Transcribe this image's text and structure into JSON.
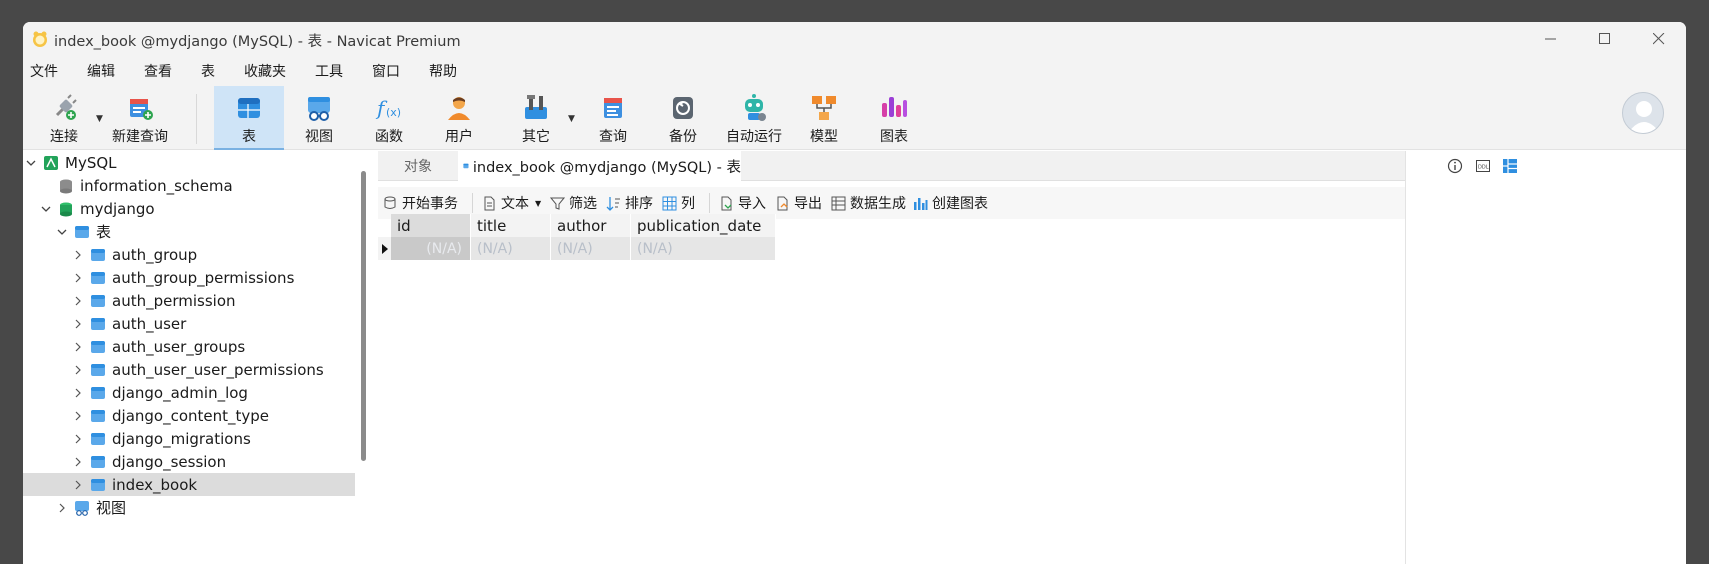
{
  "window": {
    "title": "index_book @mydjango (MySQL) - 表 - Navicat Premium"
  },
  "menu": [
    "文件",
    "编辑",
    "查看",
    "表",
    "收藏夹",
    "工具",
    "窗口",
    "帮助"
  ],
  "toolbar": {
    "connect": "连接",
    "new_query": "新建查询",
    "table": "表",
    "view": "视图",
    "function": "函数",
    "user": "用户",
    "other": "其它",
    "query": "查询",
    "backup": "备份",
    "automation": "自动运行",
    "model": "模型",
    "chart": "图表"
  },
  "tree": {
    "connection": "MySQL",
    "databases": [
      "information_schema",
      "mydjango"
    ],
    "tables_group": "表",
    "tables": [
      "auth_group",
      "auth_group_permissions",
      "auth_permission",
      "auth_user",
      "auth_user_groups",
      "auth_user_user_permissions",
      "django_admin_log",
      "django_content_type",
      "django_migrations",
      "django_session",
      "index_book"
    ],
    "views_group": "视图",
    "selected": "index_book"
  },
  "tabs": {
    "objects": "对象",
    "active": "index_book @mydjango (MySQL) - 表"
  },
  "actions": {
    "begin_transaction": "开始事务",
    "text": "文本",
    "filter": "筛选",
    "sort": "排序",
    "columns": "列",
    "import": "导入",
    "export": "导出",
    "data_generation": "数据生成",
    "create_chart": "创建图表"
  },
  "grid": {
    "columns": [
      "id",
      "title",
      "author",
      "publication_date"
    ],
    "rows": [
      [
        "(N/A)",
        "(N/A)",
        "(N/A)",
        "(N/A)"
      ]
    ]
  },
  "colors": {
    "selected_tool_bg": "#cfe4f7",
    "table_icon_blue": "#2f8fe0",
    "db_green": "#22a35a"
  }
}
